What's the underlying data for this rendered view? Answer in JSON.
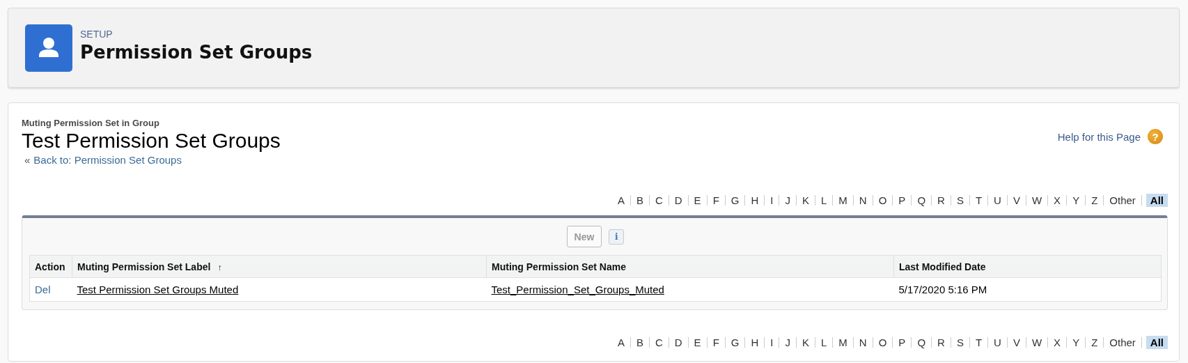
{
  "header": {
    "eyebrow": "SETUP",
    "title": "Permission Set Groups"
  },
  "page": {
    "context": "Muting Permission Set in Group",
    "title": "Test Permission Set Groups",
    "back_prefix": "«",
    "back_link": "Back to: Permission Set Groups",
    "help": "Help for this Page",
    "help_icon": "?"
  },
  "alpha_top": [
    {
      "label": "A",
      "selected": false
    },
    {
      "label": "B",
      "selected": false
    },
    {
      "label": "C",
      "selected": false
    },
    {
      "label": "D",
      "selected": false
    },
    {
      "label": "E",
      "selected": false
    },
    {
      "label": "F",
      "selected": false
    },
    {
      "label": "G",
      "selected": false
    },
    {
      "label": "H",
      "selected": false
    },
    {
      "label": "I",
      "selected": false
    },
    {
      "label": "J",
      "selected": false
    },
    {
      "label": "K",
      "selected": false
    },
    {
      "label": "L",
      "selected": false
    },
    {
      "label": "M",
      "selected": false
    },
    {
      "label": "N",
      "selected": false
    },
    {
      "label": "O",
      "selected": false
    },
    {
      "label": "P",
      "selected": false
    },
    {
      "label": "Q",
      "selected": false
    },
    {
      "label": "R",
      "selected": false
    },
    {
      "label": "S",
      "selected": false
    },
    {
      "label": "T",
      "selected": false
    },
    {
      "label": "U",
      "selected": false
    },
    {
      "label": "V",
      "selected": false
    },
    {
      "label": "W",
      "selected": false
    },
    {
      "label": "X",
      "selected": false
    },
    {
      "label": "Y",
      "selected": false
    },
    {
      "label": "Z",
      "selected": false
    },
    {
      "label": "Other",
      "selected": false
    },
    {
      "label": "All",
      "selected": true
    }
  ],
  "toolbar": {
    "new_button": "New",
    "info_button": "i"
  },
  "table": {
    "columns": [
      {
        "label": "Action"
      },
      {
        "label": "Muting Permission Set Label",
        "sort_icon": "↑"
      },
      {
        "label": "Muting Permission Set Name"
      },
      {
        "label": "Last Modified Date"
      }
    ],
    "rows": [
      {
        "action": "Del",
        "label": "Test Permission Set Groups Muted",
        "name": "Test_Permission_Set_Groups_Muted",
        "modified": "5/17/2020 5:16 PM"
      }
    ]
  },
  "alpha_bottom": [
    {
      "label": "A",
      "selected": false
    },
    {
      "label": "B",
      "selected": false
    },
    {
      "label": "C",
      "selected": false
    },
    {
      "label": "D",
      "selected": false
    },
    {
      "label": "E",
      "selected": false
    },
    {
      "label": "F",
      "selected": false
    },
    {
      "label": "G",
      "selected": false
    },
    {
      "label": "H",
      "selected": false
    },
    {
      "label": "I",
      "selected": false
    },
    {
      "label": "J",
      "selected": false
    },
    {
      "label": "K",
      "selected": false
    },
    {
      "label": "L",
      "selected": false
    },
    {
      "label": "M",
      "selected": false
    },
    {
      "label": "N",
      "selected": false
    },
    {
      "label": "O",
      "selected": false
    },
    {
      "label": "P",
      "selected": false
    },
    {
      "label": "Q",
      "selected": false
    },
    {
      "label": "R",
      "selected": false
    },
    {
      "label": "S",
      "selected": false
    },
    {
      "label": "T",
      "selected": false
    },
    {
      "label": "U",
      "selected": false
    },
    {
      "label": "V",
      "selected": false
    },
    {
      "label": "W",
      "selected": false
    },
    {
      "label": "X",
      "selected": false
    },
    {
      "label": "Y",
      "selected": false
    },
    {
      "label": "Z",
      "selected": false
    },
    {
      "label": "Other",
      "selected": false
    },
    {
      "label": "All",
      "selected": true
    }
  ]
}
